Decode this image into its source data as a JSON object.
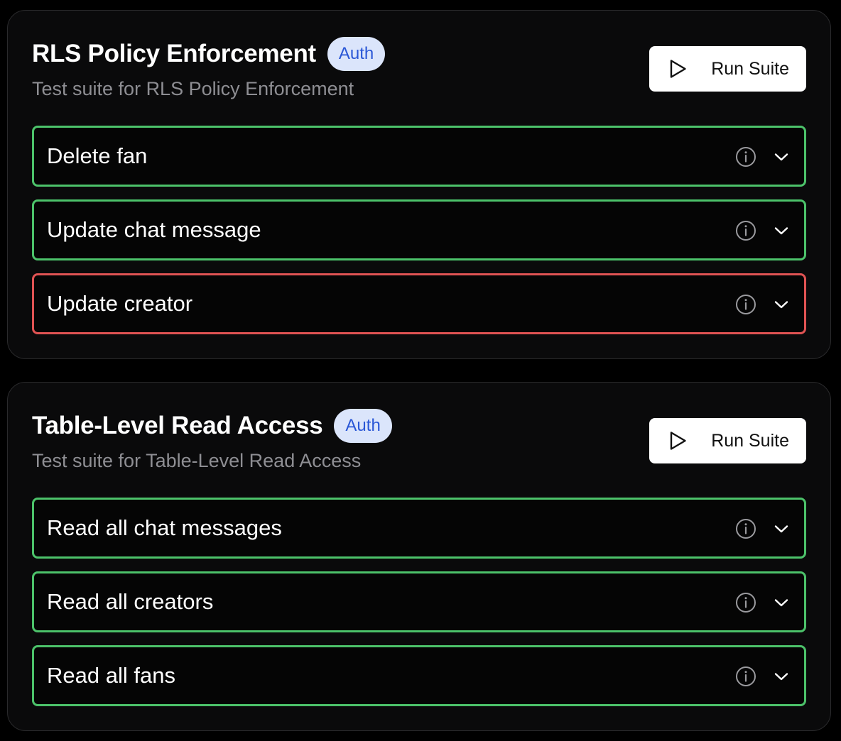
{
  "suites": [
    {
      "title": "RLS Policy Enforcement",
      "badge": "Auth",
      "subtitle": "Test suite for RLS Policy Enforcement",
      "run_button_label": "Run Suite",
      "tests": [
        {
          "label": "Delete fan",
          "status": "pass"
        },
        {
          "label": "Update chat message",
          "status": "pass"
        },
        {
          "label": "Update creator",
          "status": "fail"
        }
      ]
    },
    {
      "title": "Table-Level Read Access",
      "badge": "Auth",
      "subtitle": "Test suite for Table-Level Read Access",
      "run_button_label": "Run Suite",
      "tests": [
        {
          "label": "Read all chat messages",
          "status": "pass"
        },
        {
          "label": "Read all creators",
          "status": "pass"
        },
        {
          "label": "Read all fans",
          "status": "pass"
        }
      ]
    }
  ],
  "icons": {
    "run": "play-icon",
    "info": "info-icon",
    "expand": "chevron-down-icon"
  },
  "colors": {
    "pass_border": "#4cc26a",
    "fail_border": "#e05353",
    "badge_bg": "#dbe5fb",
    "badge_text": "#2a57d6"
  }
}
